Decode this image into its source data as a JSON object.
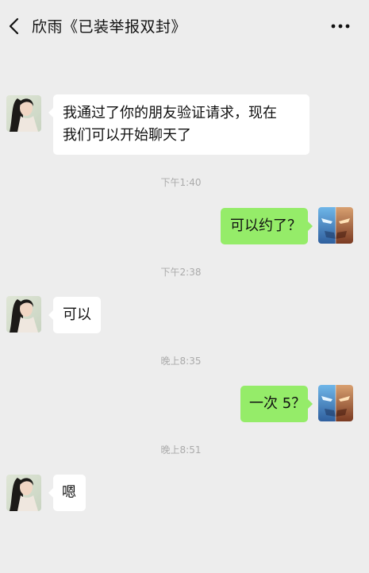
{
  "header": {
    "title": "欣雨《已装举报双封》",
    "back_icon": "chevron-left-icon",
    "more_icon": "more-dots-icon"
  },
  "messages": [
    {
      "type": "received",
      "lines": [
        "我通过了你的朋友验证请求，现在",
        "我们可以开始聊天了"
      ]
    },
    {
      "type": "time",
      "text": "下午1:40"
    },
    {
      "type": "sent",
      "text": "可以约了？"
    },
    {
      "type": "time",
      "text": "下午2:38"
    },
    {
      "type": "received",
      "text": "可以"
    },
    {
      "type": "time",
      "text": "晚上8:35"
    },
    {
      "type": "sent",
      "text": "一次 5？"
    },
    {
      "type": "time",
      "text": "晚上8:51"
    },
    {
      "type": "received",
      "text": "嗯"
    }
  ],
  "colors": {
    "background": "#ededed",
    "sent_bubble": "#95ec69",
    "received_bubble": "#ffffff",
    "timestamp": "#ababab"
  }
}
